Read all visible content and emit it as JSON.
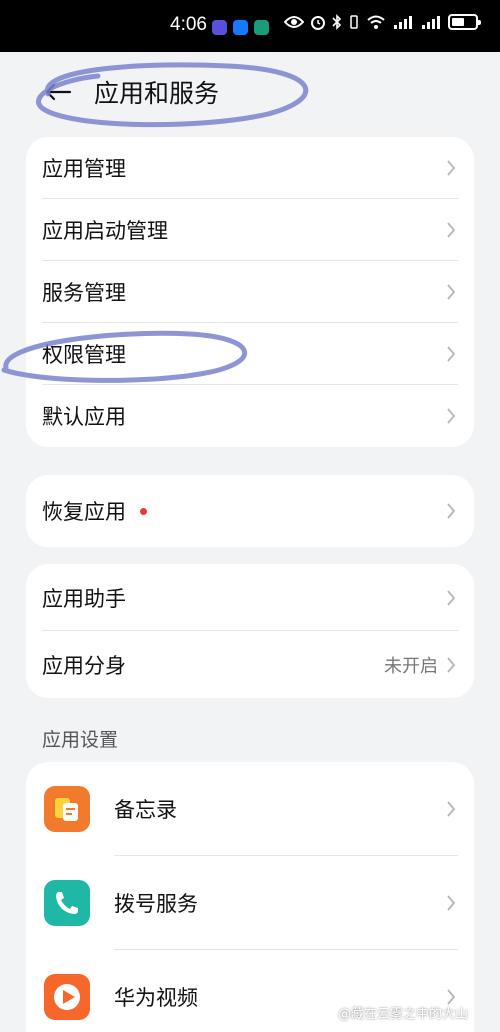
{
  "status_bar": {
    "time": "4:06"
  },
  "header": {
    "title": "应用和服务"
  },
  "cards": {
    "main": [
      {
        "label": "应用管理"
      },
      {
        "label": "应用启动管理"
      },
      {
        "label": "服务管理"
      },
      {
        "label": "权限管理"
      },
      {
        "label": "默认应用"
      }
    ],
    "restore": {
      "label": "恢复应用"
    },
    "assist": [
      {
        "label": "应用助手"
      },
      {
        "label": "应用分身",
        "value": "未开启"
      }
    ]
  },
  "app_settings": {
    "section_title": "应用设置",
    "apps": [
      {
        "label": "备忘录",
        "icon": "memo-icon",
        "color": "#f27a2c"
      },
      {
        "label": "拨号服务",
        "icon": "phone-icon",
        "color": "#1fb8a6"
      },
      {
        "label": "华为视频",
        "icon": "video-icon",
        "color": "#f5672a"
      }
    ]
  },
  "watermark": "@藏在云雾之中的大山",
  "colors": {
    "annotation": "#7a82cc",
    "background": "#f1f3f5",
    "red_dot": "#e53935"
  }
}
